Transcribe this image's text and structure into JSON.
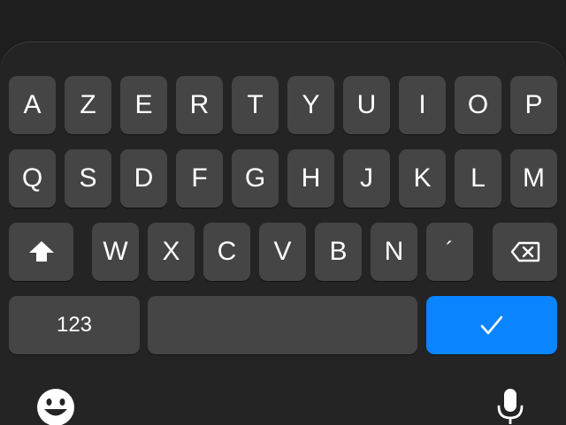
{
  "keyboard": {
    "row1": [
      "A",
      "Z",
      "E",
      "R",
      "T",
      "Y",
      "U",
      "I",
      "O",
      "P"
    ],
    "row2": [
      "Q",
      "S",
      "D",
      "F",
      "G",
      "H",
      "J",
      "K",
      "L",
      "M"
    ],
    "row3": [
      "W",
      "X",
      "C",
      "V",
      "B",
      "N",
      "´"
    ],
    "numbers_label": "123",
    "space_label": ""
  },
  "icons": {
    "shift": "shift-icon",
    "delete": "backspace-icon",
    "done": "checkmark-icon",
    "emoji": "emoji-icon",
    "dictation": "microphone-icon"
  },
  "colors": {
    "background": "#1e1e1e",
    "keyboard": "#242424",
    "key": "#454545",
    "accent": "#0a84ff"
  }
}
